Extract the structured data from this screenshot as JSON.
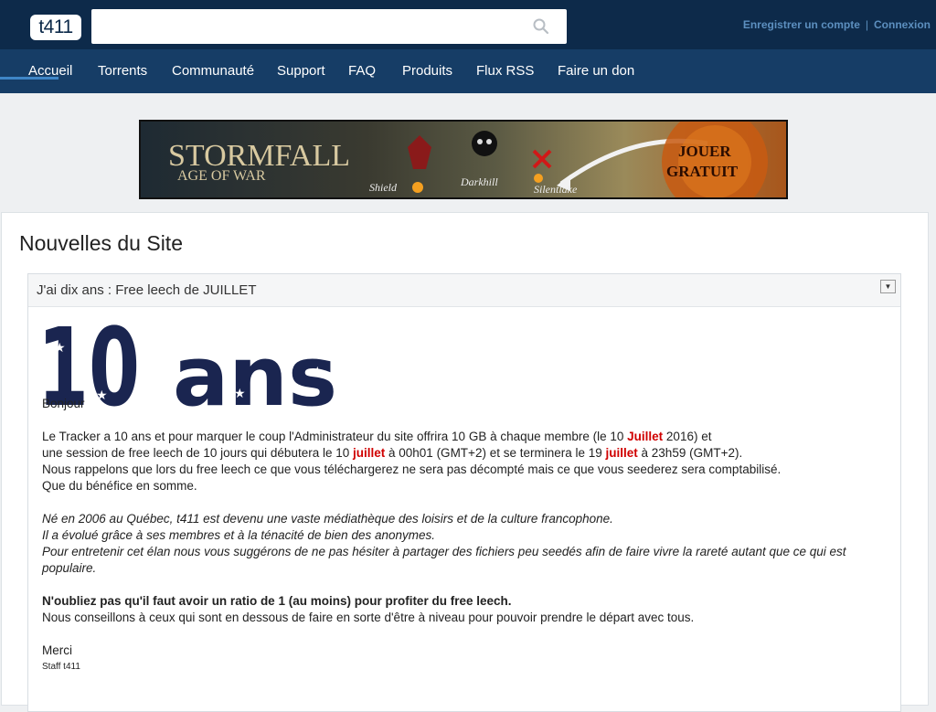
{
  "header": {
    "logo_text": "t411",
    "search_placeholder": "",
    "register_label": "Enregistrer un compte",
    "login_label": "Connexion",
    "separator": "|"
  },
  "nav": {
    "items": [
      "Accueil",
      "Torrents",
      "Communauté",
      "Support",
      "FAQ",
      "Produits",
      "Flux RSS",
      "Faire un don"
    ],
    "active": "Accueil"
  },
  "banner": {
    "title": "STORMFALL",
    "subtitle": "AGE OF WAR",
    "places": [
      "Shield",
      "Darkhill",
      "Silentlake"
    ],
    "cta_line1": "JOUER",
    "cta_line2": "GRATUIT"
  },
  "page": {
    "title": "Nouvelles du Site"
  },
  "news": {
    "title": "J'ai dix ans : Free leech de JUILLET",
    "logo_text": "10 ans",
    "greeting": "Bonjour",
    "p1_a": "Le Tracker a 10 ans et pour marquer le coup l'Administrateur du site offrira 10 GB à chaque membre (le 10 ",
    "p1_red1": "Juillet",
    "p1_b": " 2016) et",
    "p1_c": "une session de free leech de 10 jours qui débutera le 10 ",
    "p1_red2": "juillet",
    "p1_d": " à 00h01 (GMT+2) et se terminera le 19 ",
    "p1_red3": "juillet",
    "p1_e": " à 23h59 (GMT+2).",
    "p1_f": "Nous rappelons que lors du free leech ce que vous téléchargerez ne sera pas décompté mais ce que vous seederez sera comptabilisé.",
    "p1_g": "Que du bénéfice en somme.",
    "p2_a": "Né en 2006 au Québec, t411 est devenu une vaste médiathèque des loisirs et de la culture francophone.",
    "p2_b": "Il a évolué grâce à ses membres et à la ténacité de bien des anonymes.",
    "p2_c": "Pour entretenir cet élan nous vous suggérons de ne pas hésiter à partager des fichiers peu seedés afin de faire vivre la rareté autant que ce qui est populaire.",
    "p3_bold": "N'oubliez pas qu'il faut avoir un ratio de 1 (au moins) pour profiter du free leech.",
    "p3_b": "Nous conseillons à ceux qui sont en dessous de faire en sorte d'être à niveau pour pouvoir prendre le départ avec tous.",
    "thanks": "Merci",
    "signature": "Staff t411"
  },
  "colors": {
    "topbar": "#0d2a4a",
    "navbar": "#163d66",
    "accent": "#3f86c7",
    "red_text": "#d00000",
    "logo_navy": "#1a2550"
  }
}
